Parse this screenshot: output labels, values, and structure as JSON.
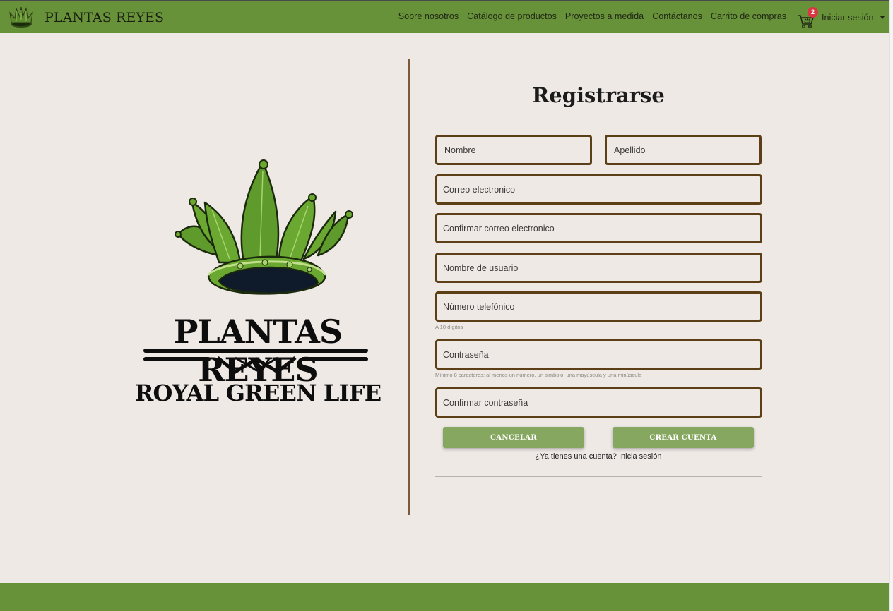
{
  "navbar": {
    "brand": "PLANTAS REYES",
    "links": [
      "Sobre nosotros",
      "Catálogo de productos",
      "Proyectos a medida",
      "Contáctanos",
      "Carrito de compras"
    ],
    "cart_count": "2",
    "login_label": "Iniciar sesión"
  },
  "hero": {
    "brand": "PLANTAS REYES",
    "tagline": "ROYAL GREEN LIFE"
  },
  "form": {
    "title": "Registrarse",
    "fields": {
      "first_name": "Nombre",
      "last_name": "Apellido",
      "email": "Correo electronico",
      "email_confirm": "Confirmar correo electronico",
      "username": "Nombre de usuario",
      "phone": "Número telefónico",
      "password": "Contraseña",
      "password_confirm": "Confirmar contraseña"
    },
    "hints": {
      "phone": "A 10 dígitos",
      "password": "Mínimo 8 caracteres: al menos un número, un símbolo, una mayúscula y una minúscula"
    },
    "cancel_label": "CANCELAR",
    "create_label": "CREAR CUENTA",
    "login_prompt": "¿Ya tienes una cuenta? Inicia sesión"
  },
  "colors": {
    "navbar": "#67923a",
    "background": "#efe9e6",
    "field_border": "#5c3f16",
    "button": "#86a760",
    "badge": "#dc3545"
  }
}
